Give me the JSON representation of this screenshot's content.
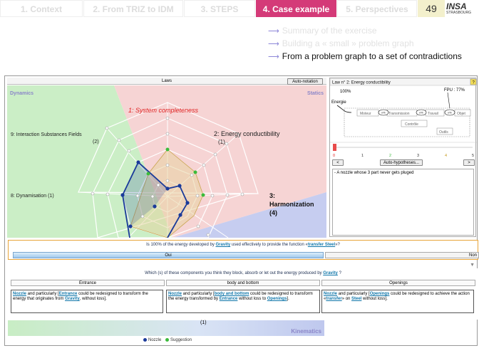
{
  "nav": {
    "tabs": [
      {
        "label": "1. Context",
        "active": false
      },
      {
        "label": "2. From TRIZ to IDM",
        "active": false
      },
      {
        "label": "3. STEPS",
        "active": false
      },
      {
        "label": "4. Case example",
        "active": true
      },
      {
        "label": "5. Perspectives",
        "active": false
      }
    ],
    "page_number": "49",
    "logo_text": "INSA",
    "logo_sub": "STRASBOURG"
  },
  "outline": {
    "items": [
      "Summary of the exercise",
      "Building a « small » problem graph",
      "From a problem graph to a set of contradictions"
    ]
  },
  "app": {
    "laws_title": "Laws",
    "auto_notation": "Auto-notation",
    "radar": {
      "dynamics": "Dynamics",
      "statics": "Statics",
      "law1": "1: System completeness",
      "law2a": "2: Energy conductibility",
      "law2b": "(1)",
      "law3a": "3:",
      "law3b": "Harmonization",
      "law3c": "(4)",
      "law9a": "9: Interaction Substances Fields",
      "law9b": "(2)",
      "law8": "8: Dynamisation (1)"
    },
    "right": {
      "title": "Law n° 2: Energy conductibility",
      "help": "?",
      "pct_left": "100%",
      "energie": "Energie",
      "fpu": "FPU : 77%",
      "diag": {
        "moteur": "Moteur",
        "transmission": "Transmission",
        "travail": "Travail",
        "objet": "Objet",
        "controle": "Contrôle",
        "outils": "Outils",
        "badge": "x%"
      },
      "ticks": [
        "0",
        "1",
        "2",
        "3",
        "4",
        "5"
      ],
      "prev": "<",
      "auto_hyp": "Auto-hypotheses...",
      "next": ">",
      "hypothesis": "- A nozzle whose 3 part never gets pluged"
    },
    "q1": {
      "pre": "Is 100% of the energy developed by ",
      "k1": "Gravity",
      "mid": " used effectively to provide the function «",
      "k2": "transfer Steel",
      "post": "»?",
      "oui": "Oui",
      "non": "Non"
    },
    "q2": {
      "pre": "Which (s) of these components you think they block, absorb or let out the energy produced by ",
      "k1": "Gravity",
      "post": " ?",
      "cols": [
        "Entrance",
        "body and bottom",
        "Openings"
      ],
      "c1": {
        "a": "Nozzle",
        "b": " and particularly [",
        "c": "Entrance",
        "d": " could be redesigned to transform the energy that originates from ",
        "e": "Gravity",
        "f": ", without loss]."
      },
      "c2": {
        "a": "Nozzle",
        "b": " and particularly [",
        "c": "body and bottom",
        "d": " could be redesigned to transform the energy transformed by ",
        "e": "Entrance",
        "f": " without loss to ",
        "g": "Openings",
        "h": "]."
      },
      "c3": {
        "a": "Nozzle",
        "b": " and particularly [",
        "c": "Openings",
        "d": " could be redesigned to achieve the action «",
        "e": "transfer",
        "f": "» on ",
        "g": "Steel",
        "h": " without loss]."
      }
    },
    "kinematics": "Kinematics",
    "kin_num": "(1)",
    "legend": {
      "nozzle": "Nozzle",
      "suggestion": "Suggestion"
    }
  },
  "colors": {
    "accent": "#d43a78",
    "nozzle": "#1a3a9a",
    "suggestion": "#3bbb3b"
  }
}
